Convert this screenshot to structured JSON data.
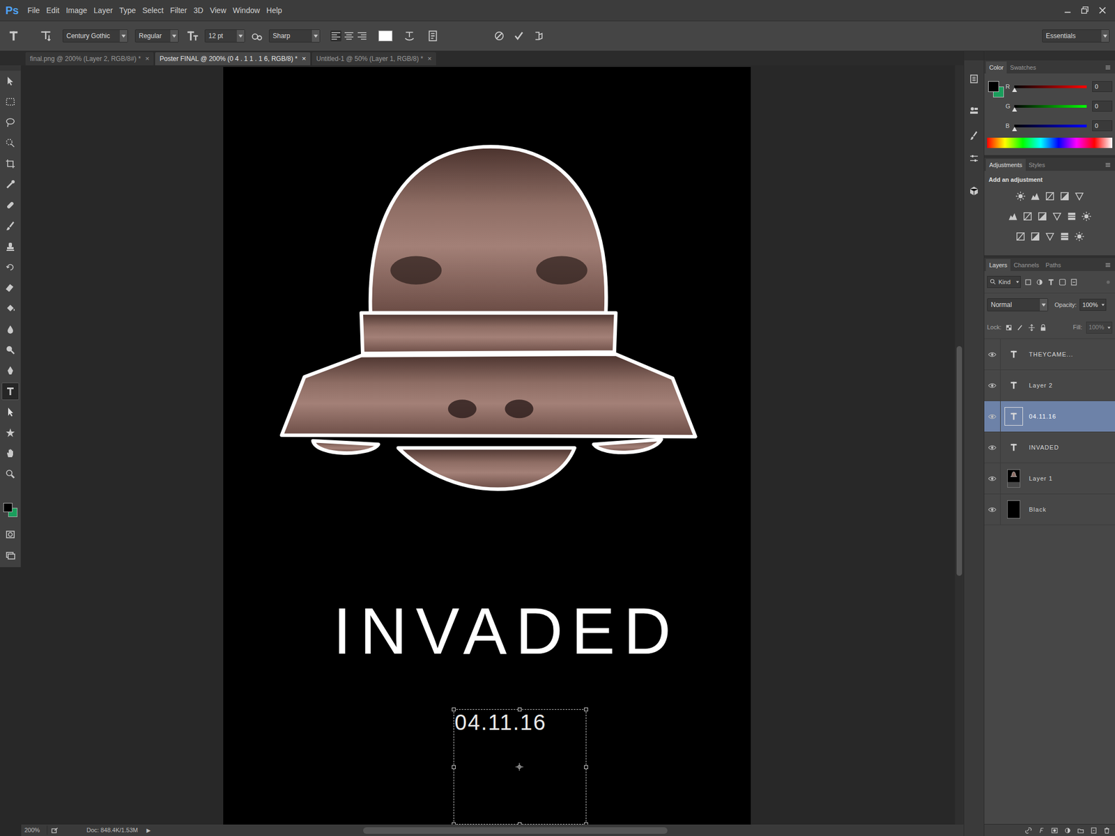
{
  "app": {
    "logo": "Ps"
  },
  "menu": [
    "File",
    "Edit",
    "Image",
    "Layer",
    "Type",
    "Select",
    "Filter",
    "3D",
    "View",
    "Window",
    "Help"
  ],
  "options_bar": {
    "font_family": "Century Gothic",
    "font_style": "Regular",
    "font_size": "12 pt",
    "anti_alias": "Sharp",
    "text_color": "#ffffff",
    "workspace": "Essentials"
  },
  "tabs": [
    {
      "label": "final.png @ 200% (Layer 2, RGB/8#) *",
      "close": "×",
      "selected": false
    },
    {
      "label": "Poster FINAL @ 200% (0 4 . 1 1 . 1 6, RGB/8) *",
      "close": "×",
      "selected": true
    },
    {
      "label": "Untitled-1 @ 50% (Layer 1, RGB/8) *",
      "close": "×",
      "selected": false
    }
  ],
  "tools": [
    {
      "selected": false
    },
    {
      "selected": false
    },
    {
      "selected": false
    },
    {
      "selected": false
    },
    {
      "selected": false
    },
    {
      "selected": false
    },
    {
      "selected": false
    },
    {
      "selected": false
    },
    {
      "selected": false
    },
    {
      "selected": false
    },
    {
      "selected": false
    },
    {
      "selected": false
    },
    {
      "selected": false
    },
    {
      "selected": false
    },
    {
      "selected": false
    },
    {
      "selected": true
    },
    {
      "selected": false
    },
    {
      "selected": false
    },
    {
      "selected": false
    },
    {
      "selected": false
    }
  ],
  "swatches": {
    "foreground": "#000000",
    "background": "#1a9e5c"
  },
  "canvas": {
    "title": "INVADED",
    "date": "04.11.16"
  },
  "color_panel": {
    "tabs": [
      {
        "label": "Color",
        "selected": true
      },
      {
        "label": "Swatches",
        "selected": false
      }
    ],
    "channels": [
      {
        "name": "R",
        "value": "0",
        "level": 0
      },
      {
        "name": "G",
        "value": "0",
        "level": 0
      },
      {
        "name": "B",
        "value": "0",
        "level": 0
      }
    ]
  },
  "adjustments_panel": {
    "tabs": [
      {
        "label": "Adjustments",
        "selected": true
      },
      {
        "label": "Styles",
        "selected": false
      }
    ],
    "hint": "Add an adjustment"
  },
  "layers_panel": {
    "tabs": [
      {
        "label": "Layers",
        "selected": true
      },
      {
        "label": "Channels",
        "selected": false
      },
      {
        "label": "Paths",
        "selected": false
      }
    ],
    "filter": "Kind",
    "blend_mode": "Normal",
    "opacity_label": "Opacity:",
    "opacity": "100%",
    "lock_label": "Lock:",
    "fill_label": "Fill:",
    "fill": "100%",
    "layers": [
      {
        "name": "THEYCAME...",
        "kind": "text",
        "visible": true,
        "selected": false
      },
      {
        "name": "Layer 2",
        "kind": "text",
        "visible": true,
        "selected": false
      },
      {
        "name": "04.11.16",
        "kind": "text",
        "visible": true,
        "selected": true
      },
      {
        "name": "INVADED",
        "kind": "text",
        "visible": true,
        "selected": false
      },
      {
        "name": "Layer 1",
        "kind": "image",
        "visible": true,
        "selected": false
      },
      {
        "name": "Black",
        "kind": "fill",
        "visible": true,
        "selected": false
      }
    ]
  },
  "status_bar": {
    "zoom": "200%",
    "doc": "Doc: 848.4K/1.53M",
    "arrow": "▶"
  }
}
